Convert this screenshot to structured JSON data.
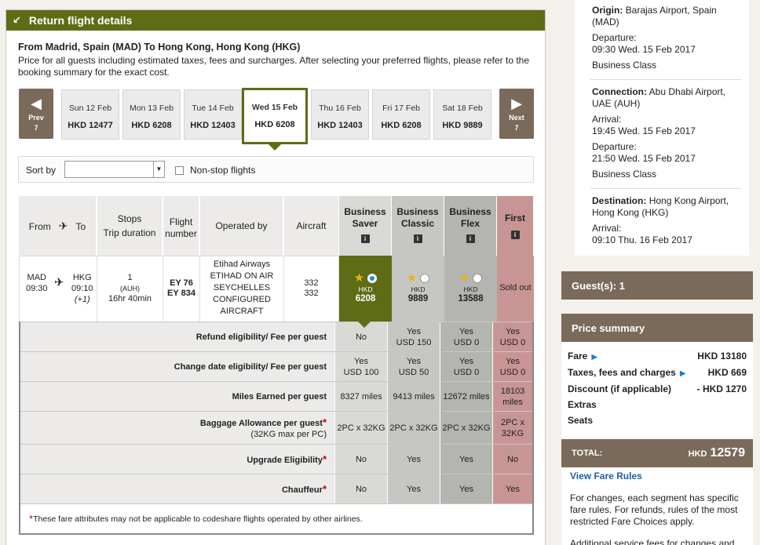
{
  "header": {
    "title": "Return flight details"
  },
  "route_title": "From Madrid, Spain (MAD) To Hong Kong, Hong Kong (HKG)",
  "price_note": "Price for all guests including estimated taxes, fees and surcharges. After selecting your preferred flights, please refer to the booking summary for the exact cost.",
  "nav": {
    "prev_label": "Prev",
    "prev_count": "7",
    "next_label": "Next",
    "next_count": "7"
  },
  "dates": [
    {
      "day": "Sun 12 Feb",
      "price": "HKD 12477"
    },
    {
      "day": "Mon 13 Feb",
      "price": "HKD 6208"
    },
    {
      "day": "Tue 14 Feb",
      "price": "HKD 12403"
    },
    {
      "day": "Wed 15 Feb",
      "price": "HKD 6208",
      "selected": true
    },
    {
      "day": "Thu 16 Feb",
      "price": "HKD 12403"
    },
    {
      "day": "Fri 17 Feb",
      "price": "HKD 6208"
    },
    {
      "day": "Sat 18 Feb",
      "price": "HKD 9889"
    }
  ],
  "sort": {
    "label": "Sort by",
    "value": "",
    "nonstop_label": "Non-stop flights"
  },
  "table": {
    "headers": {
      "from": "From",
      "to": "To",
      "stops": "Stops",
      "trip_duration": "Trip duration",
      "flight": "Flight",
      "number": "number",
      "operated_by": "Operated by",
      "aircraft": "Aircraft"
    },
    "fares": [
      {
        "line1": "Business",
        "line2": "Saver"
      },
      {
        "line1": "Business",
        "line2": "Classic"
      },
      {
        "line1": "Business",
        "line2": "Flex"
      },
      {
        "line1": "First",
        "line2": ""
      }
    ],
    "flight": {
      "from_code": "MAD",
      "from_time": "09:30",
      "to_code": "HKG",
      "to_time": "09:10",
      "day_offset": "(+1)",
      "stops": "1",
      "stop_via": "(AUH)",
      "duration": "16hr 40min",
      "flight_numbers": [
        "EY 76",
        "EY 834"
      ],
      "operator": [
        "Etihad Airways",
        "ETIHAD ON AIR",
        "SEYCHELLES",
        "CONFIGURED",
        "AIRCRAFT"
      ],
      "aircraft": [
        "332",
        "332"
      ]
    },
    "fare_prices": [
      {
        "currency": "HKD",
        "amount": "6208"
      },
      {
        "currency": "HKD",
        "amount": "9889"
      },
      {
        "currency": "HKD",
        "amount": "13588"
      },
      {
        "sold_out": "Sold out"
      }
    ],
    "attributes": [
      {
        "label": "Refund eligibility/ Fee per guest",
        "values": [
          [
            "No"
          ],
          [
            "Yes",
            "USD 150"
          ],
          [
            "Yes",
            "USD 0"
          ],
          [
            "Yes",
            "USD 0"
          ]
        ]
      },
      {
        "label": "Change date eligibility/ Fee per guest",
        "values": [
          [
            "Yes",
            "USD 100"
          ],
          [
            "Yes",
            "USD 50"
          ],
          [
            "Yes",
            "USD 0"
          ],
          [
            "Yes",
            "USD 0"
          ]
        ]
      },
      {
        "label": "Miles Earned per guest",
        "values": [
          [
            "8327 miles"
          ],
          [
            "9413 miles"
          ],
          [
            "12672 miles"
          ],
          [
            "18103",
            "miles"
          ]
        ]
      },
      {
        "label": "Baggage Allowance per guest",
        "sub": "(32KG max per PC)",
        "asterisk": "*",
        "values": [
          [
            "2PC x 32KG"
          ],
          [
            "2PC x 32KG"
          ],
          [
            "2PC x 32KG"
          ],
          [
            "2PC x",
            "32KG"
          ]
        ]
      },
      {
        "label": "Upgrade Eligibility",
        "asterisk": "*",
        "values": [
          [
            "No"
          ],
          [
            "Yes"
          ],
          [
            "Yes"
          ],
          [
            "No"
          ]
        ]
      },
      {
        "label": "Chauffeur",
        "asterisk": "*",
        "values": [
          [
            "No"
          ],
          [
            "Yes"
          ],
          [
            "Yes"
          ],
          [
            "Yes"
          ]
        ]
      }
    ],
    "footnote_mark": "*",
    "footnote": "These fare attributes may not be applicable to codeshare flights operated by other airlines."
  },
  "itinerary": {
    "origin_label": "Origin:",
    "origin": "Barajas Airport, Spain (MAD)",
    "origin_dep_label": "Departure:",
    "origin_dep": "09:30 Wed. 15 Feb 2017",
    "origin_class": "Business Class",
    "conn_label": "Connection:",
    "conn": "Abu Dhabi Airport, UAE (AUH)",
    "conn_arr_label": "Arrival:",
    "conn_arr": "19:45 Wed. 15 Feb 2017",
    "conn_dep_label": "Departure:",
    "conn_dep": "21:50 Wed. 15 Feb 2017",
    "conn_class": "Business Class",
    "dest_label": "Destination:",
    "dest": "Hong Kong Airport, Hong Kong (HKG)",
    "dest_arr_label": "Arrival:",
    "dest_arr": "09:10 Thu. 16 Feb 2017"
  },
  "guests": {
    "label": "Guest(s): 1"
  },
  "price_summary": {
    "title": "Price summary",
    "fare_label": "Fare",
    "fare": "HKD 13180",
    "taxes_label": "Taxes, fees and charges",
    "taxes": "HKD 669",
    "discount_label": "Discount (if applicable)",
    "discount": "- HKD 1270",
    "extras_label": "Extras",
    "seats_label": "Seats",
    "total_label": "TOTAL:",
    "total_currency": "HKD",
    "total": "12579"
  },
  "fare_rules": {
    "link": "View Fare Rules",
    "note": "For changes, each segment has specific fare rules. For refunds, rules of the most restricted Fare Choices apply.",
    "note2": "Additional service fees for changes and"
  },
  "colors": {
    "brand_green": "#5e6c16",
    "brown": "#7a6a5a",
    "link_blue": "#1a5fa6"
  }
}
